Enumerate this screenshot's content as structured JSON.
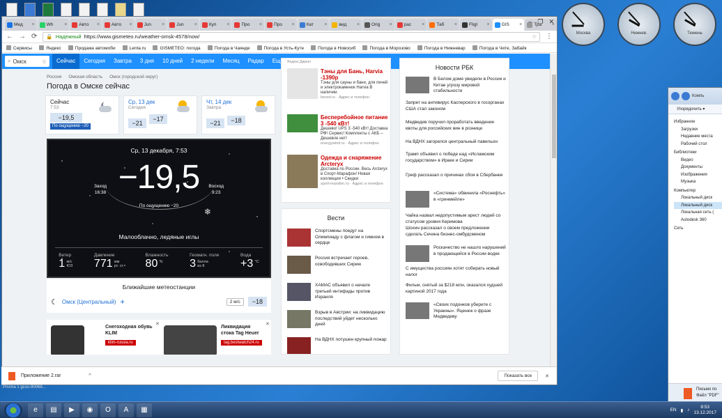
{
  "desktop": {
    "clocks": [
      "Москва",
      "Нижнев.",
      "Тюмень"
    ]
  },
  "browser": {
    "tabs": [
      "Мед",
      "Wh",
      "Авто",
      "Авто",
      "Jun",
      "Jun",
      "Куп",
      "Про",
      "Про",
      "Кат",
      "вид",
      "Orig",
      "рас",
      "Таб",
      "Fligl",
      "GIS",
      "Тра"
    ],
    "active_tab": "GIS",
    "security": "Надежный",
    "url": "https://www.gismeteo.ru/weather-omsk-4578/now/",
    "bookmarks": [
      "Сервисы",
      "Яндекс",
      "Продажа автомоби",
      "Lenta.ru",
      "GISMETEO: погода",
      "Погода в Чаянде",
      "Погода в Усть-Куте",
      "Погода в Новосиб",
      "Погода в Морозово",
      "Погода в Нижневар",
      "Погода в Чите, Забайк"
    ]
  },
  "gis": {
    "search": "Омск",
    "nav": [
      "Сейчас",
      "Сегодня",
      "Завтра",
      "3 дня",
      "10 дней",
      "2 недели",
      "Месяц",
      "Радар",
      "Ещё"
    ],
    "breadcrumb": [
      "Россия",
      "Омская область",
      "Омск (городской округ)"
    ],
    "title": "Погода в Омске сейчас",
    "cards": [
      {
        "head": "Сейчас",
        "sub": "7:53",
        "t": "−19,5",
        "feel": "По ощущению −20"
      },
      {
        "head": "Ср, 13 дек",
        "sub": "Сегодня",
        "t1": "−21",
        "t2": "−17"
      },
      {
        "head": "Чт, 14 дек",
        "sub": "Завтра",
        "t1": "−21",
        "t2": "−18"
      }
    ],
    "now": {
      "date": "Ср, 13 декабря, 7:53",
      "temp": "−19,5",
      "rise_label": "Заход",
      "rise": "16:38",
      "set_label": "Восход",
      "set": "9:23",
      "feel": "По ощущению −20",
      "cond": "Малооблачно, ледяные иглы",
      "stats": [
        {
          "l": "Ветер",
          "v": "1",
          "u1": "м/с",
          "u2": "ЮЗ"
        },
        {
          "l": "Давление",
          "v": "771",
          "u1": "мм",
          "u2": "рт. ст."
        },
        {
          "l": "Влажность",
          "v": "80",
          "u1": "%",
          "u2": ""
        },
        {
          "l": "Геомагн. поле",
          "v": "3",
          "u1": "балла",
          "u2": "из 8"
        },
        {
          "l": "Вода",
          "v": "+3",
          "u1": "°C",
          "u2": ""
        }
      ]
    },
    "near": {
      "title": "Ближайшие метеостанции",
      "station": "Омск (Центральный)",
      "wind": "2 м/с",
      "temp": "−18"
    },
    "bottom_ads": [
      {
        "t1": "Снегоходная обувь",
        "t2": "KLIM",
        "tag": "klim-russia.ru"
      },
      {
        "t1": "Ликвидация",
        "t2": "стока Tag Heuer",
        "tag": "tag.bestwatch24.ru"
      }
    ]
  },
  "ads": {
    "direct": "Яндекс.Директ",
    "items": [
      {
        "title": "Тэны для Бань, Harvia",
        "price": "-1390р",
        "desc": "Тэны для сауны и бани, для печей и электрокаменок Harvia В наличии.",
        "site": "bessd.ru",
        "contact": "Адрес и телефон"
      },
      {
        "title": "Бесперебойное питание",
        "price": "3 -540 кВт!",
        "desc": "Дешево! UPS 3 -540 кВт! Доставка РФ! Сервис! Комплекты с АКБ – Дешевле нет!",
        "site": "energywind.ru",
        "contact": "Адрес и телефон"
      },
      {
        "title": "Одежда и снаряжение Arcteryx",
        "price": "",
        "desc": "Доставка по России. Весь Arcteryx в Спорт-Марафон! Новая коллекция • Скидки",
        "site": "sport-marafon.ru",
        "contact": "Адрес и телефон"
      }
    ]
  },
  "vesti": {
    "title": "Вести",
    "items": [
      "Спортсмены поедут на Олимпиаду с флагом и гимном в сердце",
      "Россия встречает героев, освободивших Сирию",
      "ХАМАС объявил о начале третьей интифады против Израиля",
      "Взрыв в Австрии: на ликвидацию последствий уйдет несколько дней",
      "На ВДНХ потушен крупный пожар"
    ]
  },
  "rbk": {
    "title": "Новости РБК",
    "items": [
      "В Белом доме увидели в России и Китае угрозу мировой стабильности",
      "Запрет на антивирус Касперского в госорганах США стал законом",
      "Медведев поручил проработать введение квоты для российских вин в рознице",
      "На ВДНХ загорелся центральный павильон",
      "Трамп объявил о победе над «Исламским государством» в Ираке и Сирии",
      "Греф рассказал о причинах сбоя в Сбербанке",
      "«Система» обвинила «Роснефть» в «гринмейле»",
      "Чайка назвал недопустимым арест людей со статусом уровня Керимова",
      "Шохин рассказал о своем предложении сделать Сечина бизнес-омбудсменом",
      "Роскачество не нашло нарушений в продающейся в России водке",
      "С имущества россиян хотят собирать новый налог",
      "Фильм, снятый за $218 млн, оказался худшей картиной 2017 года",
      "«Своих подонков уберите с Украины». Яценюк о фразе Медведеву"
    ]
  },
  "download": {
    "file": "Приложение 2.rar",
    "show_all": "Показать все"
  },
  "explorer": {
    "path": "Компь",
    "organize": "Упорядочить ▾",
    "tree": [
      "Избранное",
      "Загрузки",
      "Недавние места",
      "Рабочий стол",
      "Библиотеки",
      "Видео",
      "Документы",
      "Изображения",
      "Музыка",
      "Компьютер",
      "Локальный диск",
      "Локальный диск",
      "Локальная сеть (",
      "Autodesk 360",
      "Сеть"
    ],
    "status1": "Письмо по",
    "status2": "Файл \"PDF\""
  },
  "taskbar": {
    "lang": "EN",
    "time": "8:53",
    "date": "13.12.2017"
  },
  "misc": {
    "sticky": "Prisma 1 gcos-90068..."
  }
}
